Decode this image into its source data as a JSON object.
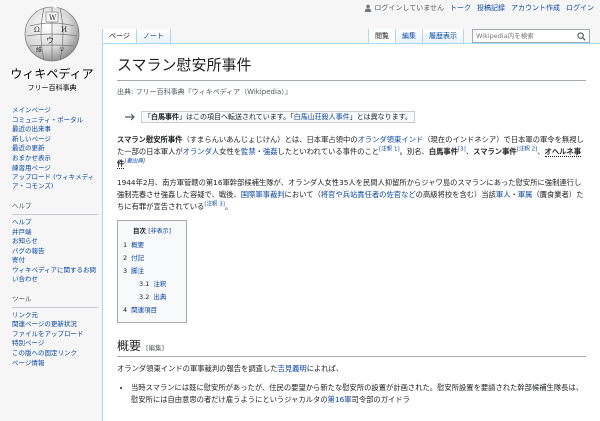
{
  "personal": {
    "not_logged_in": "ログインしていません",
    "talk": "トーク",
    "contributions": "投稿記録",
    "create_account": "アカウント作成",
    "login": "ログイン"
  },
  "logo": {
    "wordmark": "ウィキペディア",
    "tagline": "フリー百科事典"
  },
  "sidebar": {
    "navigation": {
      "items": [
        "メインページ",
        "コミュニティ・ポータル",
        "最近の出来事",
        "新しいページ",
        "最近の更新",
        "おまかせ表示",
        "練習用ページ",
        "アップロード (ウィキメディア・コモンズ)"
      ]
    },
    "help": {
      "title": "ヘルプ",
      "items": [
        "ヘルプ",
        "井戸端",
        "お知らせ",
        "バグの報告",
        "寄付",
        "ウィキペディアに関するお問い合わせ"
      ]
    },
    "tools": {
      "title": "ツール",
      "items": [
        "リンク元",
        "関連ページの更新状況",
        "ファイルをアップロード",
        "特別ページ",
        "この版への固定リンク",
        "ページ情報"
      ]
    }
  },
  "tabs": {
    "page": "ページ",
    "talk": "ノート",
    "read": "閲覧",
    "edit": "編集",
    "history": "履歴表示"
  },
  "search": {
    "placeholder": "Wikipedia内を検索"
  },
  "article": {
    "title": "スマラン慰安所事件",
    "site_sub": "出典: フリー百科事典『ウィキペディア（Wikipedia）』",
    "hatnote": {
      "prefix": "「",
      "term1": "白馬事件",
      "mid": "」はこの項目へ転送されています。「",
      "term2": "白馬山荘殺人事件",
      "suffix": "」とは異なります。"
    },
    "p1": {
      "t1": "スマラン慰安所事件",
      "t2": "（すまらんいあんじょじけん）とは、日本軍占領中の",
      "link1": "オランダ領東インド",
      "t3": "（現在のインドネシア）で日本軍の軍令を無視した一部の日本軍人が",
      "link2": "オランダ人",
      "t4": "女性を",
      "link3": "監禁",
      "t5": "・",
      "link4": "強姦",
      "t6": "したといわれている事件のこと",
      "note1": "[注釈 1]",
      "t7": "。別名、",
      "t8": "白馬事件",
      "note2": "[3]",
      "t9": "、",
      "t10": "スマラン事件",
      "note3": "[注釈 2]",
      "t11": "、",
      "t12": "オヘルネ事件",
      "note4": "[要出典]"
    },
    "p2": {
      "t1": "1944年2月、南方軍管轄の第16軍幹部候補生隊が、オランダ人女性35人を民間人抑留所からジャワ島のスマランにあった慰安所に強制連行し強制売春させ強姦した容疑で、戦後、",
      "link1": "国際軍事裁判",
      "t2": "において（",
      "link2": "将官や兵站責任者の佐官など",
      "t3": "の高級将校を含む）当該",
      "link3": "軍人",
      "t4": "・",
      "link4": "軍属",
      "t5": "（贋食業者）たちに有罪が宣告されている",
      "note1": "[注釈 3]",
      "t6": "。"
    },
    "toc": {
      "title": "目次",
      "toggle": "[非表示]",
      "items": [
        {
          "num": "1",
          "label": "概要"
        },
        {
          "num": "2",
          "label": "付記"
        },
        {
          "num": "3",
          "label": "脚注"
        },
        {
          "num": "3.1",
          "label": "注釈"
        },
        {
          "num": "3.2",
          "label": "出典"
        },
        {
          "num": "4",
          "label": "関連項目"
        }
      ]
    },
    "section1": {
      "title": "概要",
      "edit": "[編集]",
      "p1_t1": "オランダ領東インドの軍事裁判の報告を調査した",
      "p1_link": "吉見義明",
      "p1_t2": "によれば、",
      "bullet1_t1": "当時スマランには既に慰安所があったが、住民の要望から新たな慰安所の設置が計画された。慰安所設置を要請された幹部候補生隊長は、慰安所には自由意思の者だけ雇うようにというジャカルタの",
      "bullet1_link": "第16軍",
      "bullet1_t2": "司令部のガイドラ"
    }
  }
}
